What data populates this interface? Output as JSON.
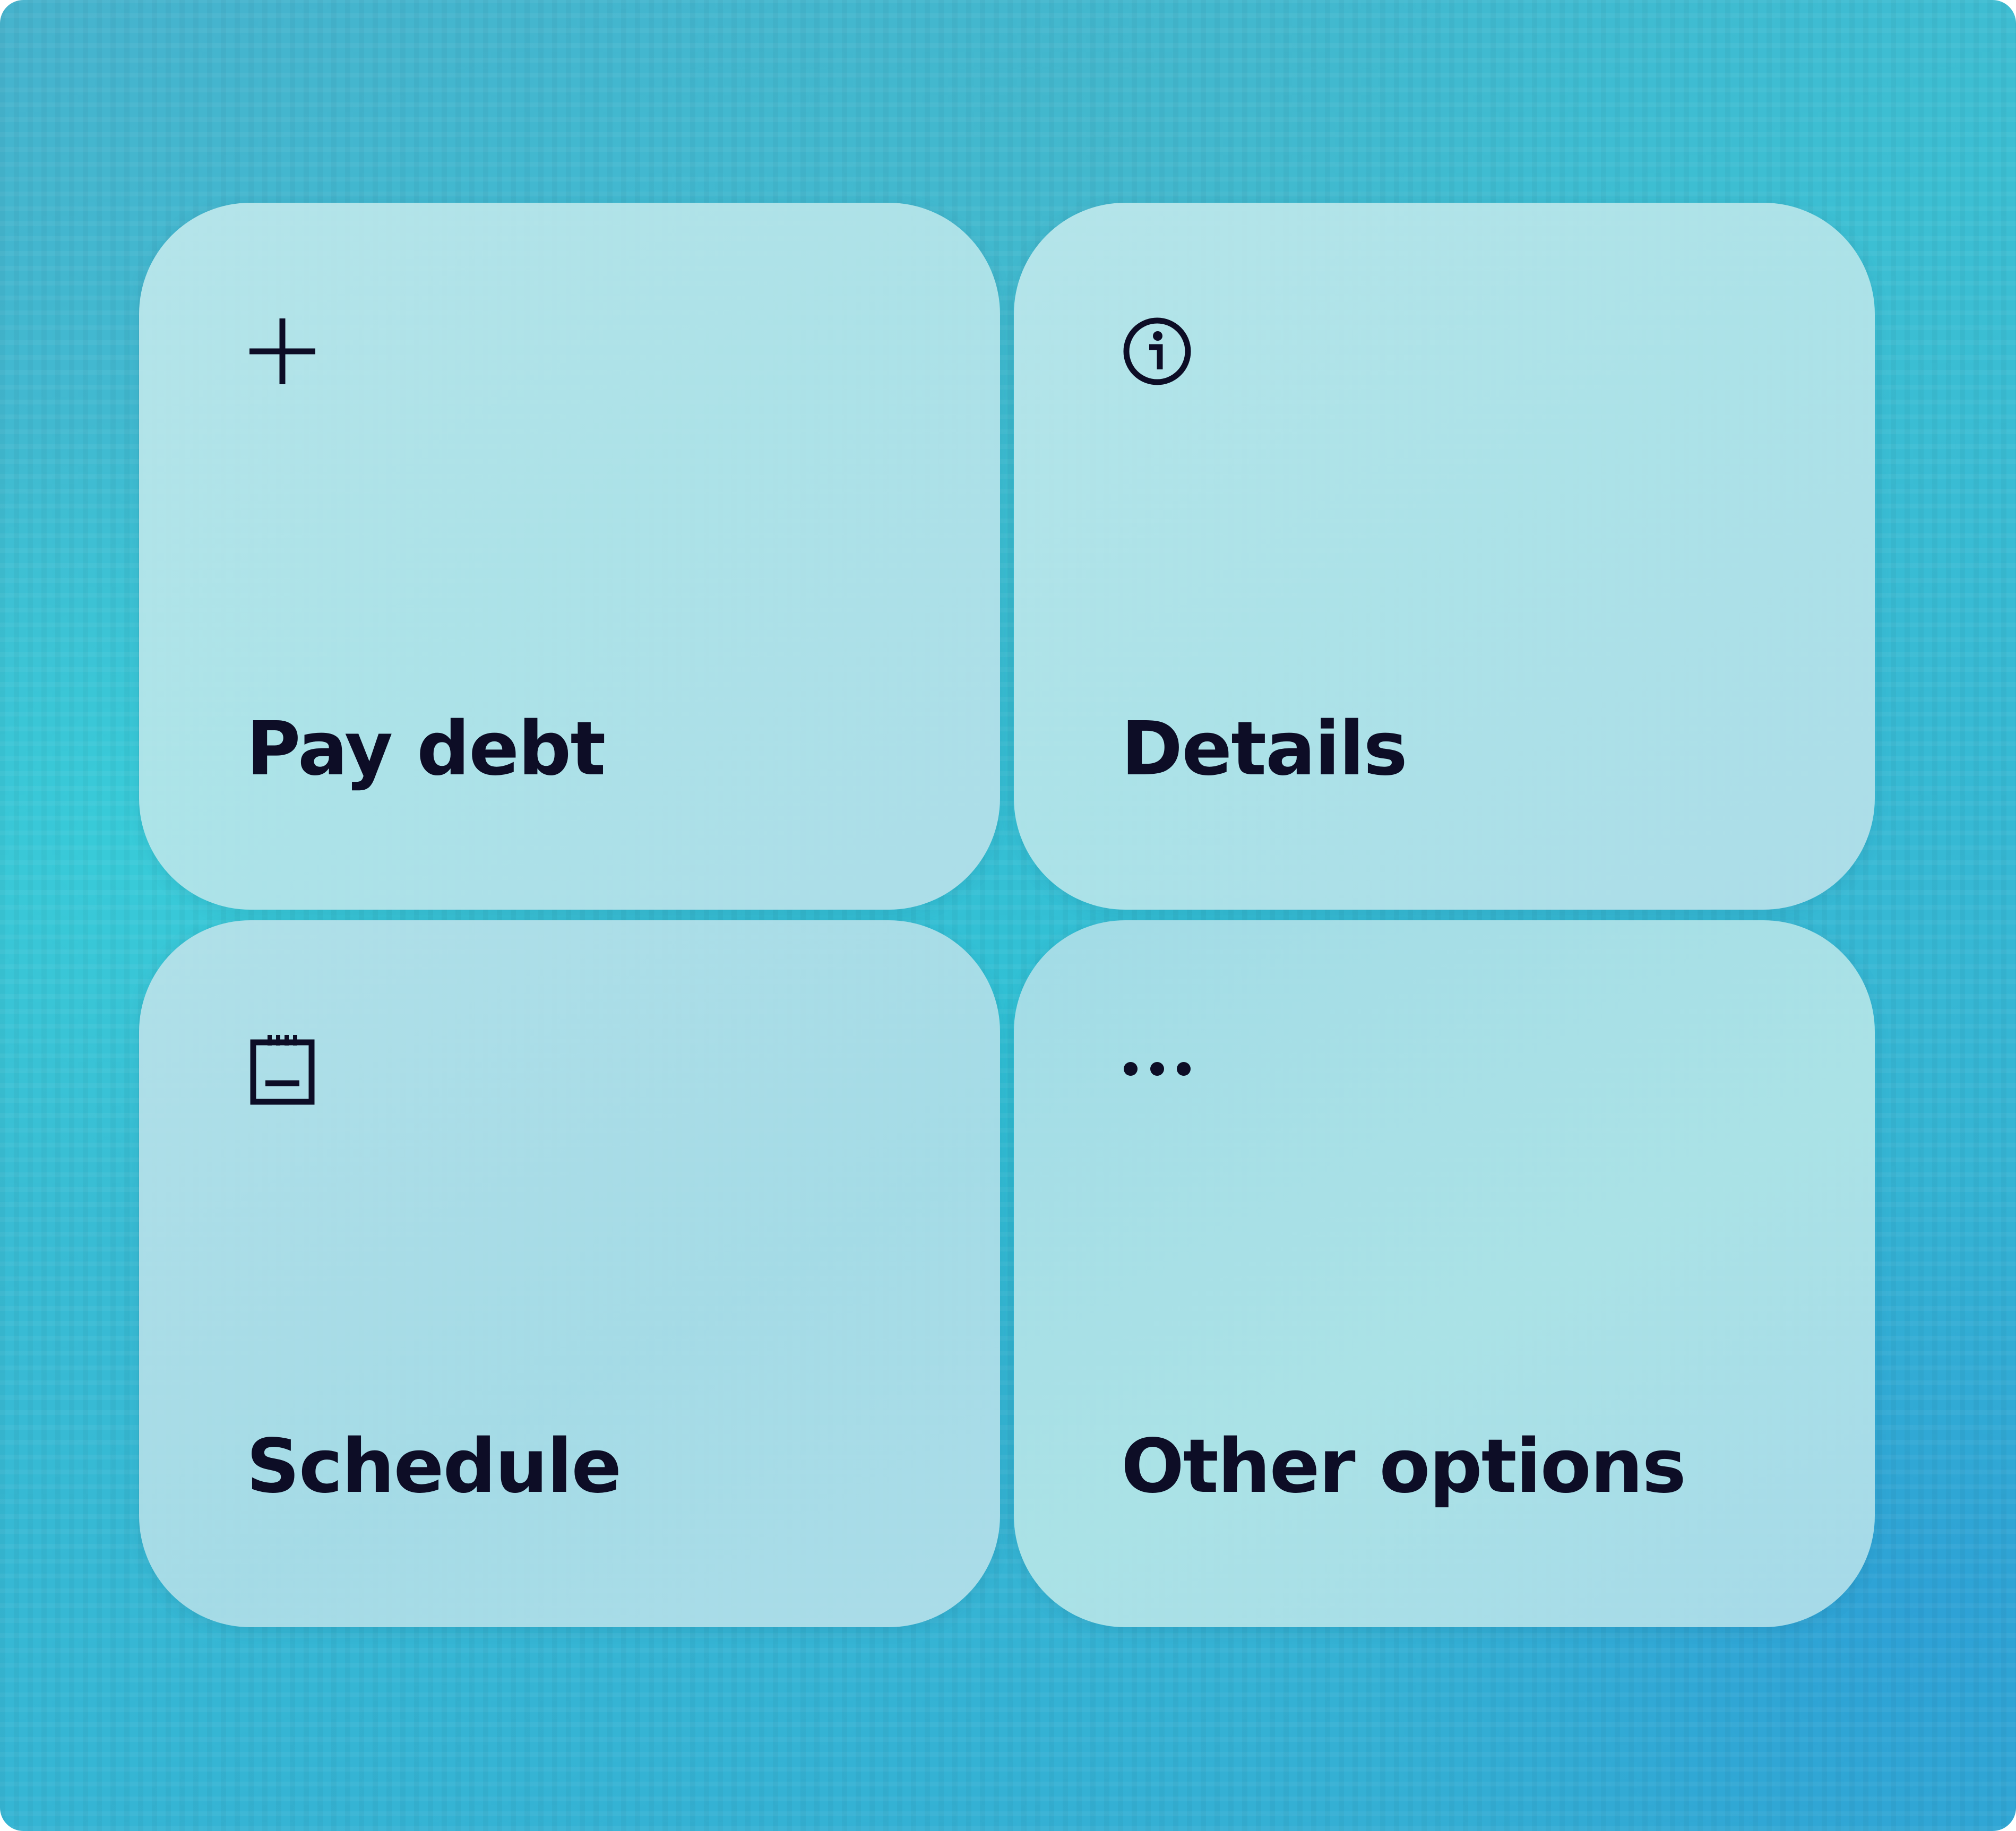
{
  "actions": {
    "tiles": [
      {
        "label": "Pay debt",
        "icon": "plus-icon"
      },
      {
        "label": "Details",
        "icon": "info-icon"
      },
      {
        "label": "Schedule",
        "icon": "calendar-icon"
      },
      {
        "label": "Other options",
        "icon": "more-horizontal-icon"
      }
    ]
  },
  "colors": {
    "text": "#0d0d26",
    "tile_background": "#b8e4ea",
    "background_accent": "#3cbfd3"
  }
}
